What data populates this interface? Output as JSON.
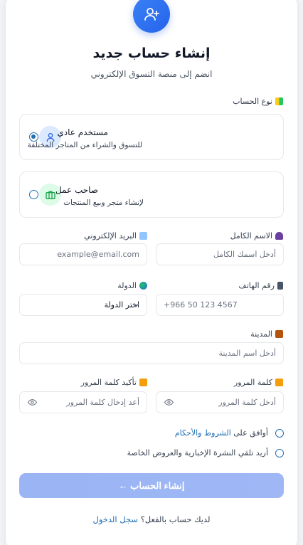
{
  "header": {
    "title": "إنشاء حساب جديد",
    "subtitle": "انضم إلى منصة التسوق الإلكتروني"
  },
  "account_type": {
    "label": "نوع الحساب",
    "options": [
      {
        "name": "مستخدم عادي",
        "description": "للتسوق والشراء من المتاجر المختلفة",
        "selected": true,
        "icon": "user-icon"
      },
      {
        "name": "صاحب عمل",
        "description": "لإنشاء متجر وبيع المنتجات",
        "selected": false,
        "icon": "briefcase-icon"
      }
    ]
  },
  "fields": {
    "full_name": {
      "label": "الاسم الكامل",
      "placeholder": "أدخل اسمك الكامل"
    },
    "email": {
      "label": "البريد الإلكتروني",
      "placeholder": "example@email.com"
    },
    "phone": {
      "label": "رقم الهاتف",
      "placeholder": "+966 50 123 4567"
    },
    "country": {
      "label": "الدولة",
      "value": "اختر الدولة"
    },
    "city": {
      "label": "المدينة",
      "placeholder": "أدخل اسم المدينة"
    },
    "password": {
      "label": "كلمة المرور",
      "placeholder": "أدخل كلمة المرور"
    },
    "confirm_password": {
      "label": "تأكيد كلمة المرور",
      "placeholder": "أعد إدخال كلمة المرور"
    }
  },
  "agreements": {
    "terms_prefix": "أوافق على ",
    "terms_link": "الشروط والأحكام",
    "newsletter": "أريد تلقي النشرة الإخبارية والعروض الخاصة"
  },
  "submit": {
    "label": "إنشاء الحساب ←"
  },
  "footer": {
    "prompt": "لديك حساب بالفعل؟ ",
    "login_link": "سجل الدخول"
  },
  "colors": {
    "accent": "#2563eb",
    "link": "#1f6fb5",
    "button": "#9ab4f4"
  }
}
